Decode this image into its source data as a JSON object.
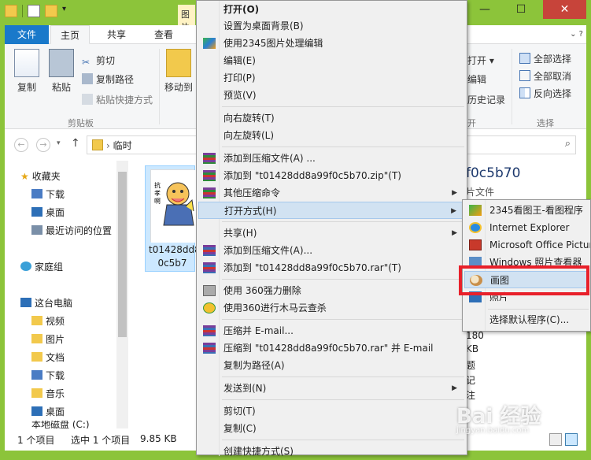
{
  "window": {
    "qat_context_tab": "图片",
    "controls": {
      "minimize": "—",
      "maximize": "☐",
      "close": "✕"
    }
  },
  "ribbon_tabs": {
    "file": "文件",
    "home": "主页",
    "share": "共享",
    "view": "查看",
    "manage": "管",
    "right_icons": "⌄  ?"
  },
  "ribbon": {
    "copy": "复制",
    "paste": "粘贴",
    "cut": "剪切",
    "copy_path": "复制路径",
    "paste_shortcut": "粘贴快捷方式",
    "move_to": "移动到",
    "clipboard_group": "剪贴板",
    "open_menu": "打开",
    "edit": "编辑",
    "history": "历史记录",
    "group_open_tail": "开",
    "select_all": "全部选择",
    "select_none": "全部取消",
    "invert_select": "反向选择",
    "select_group": "选择"
  },
  "address": {
    "path": "临时",
    "back": "←",
    "forward": "→",
    "up": "↑",
    "search_icon": "⌕"
  },
  "navpane": {
    "favorites": "收藏夹",
    "downloads": "下载",
    "desktop": "桌面",
    "recent": "最近访问的位置",
    "homegroup": "家庭组",
    "this_pc": "这台电脑",
    "videos": "视频",
    "pictures": "图片",
    "documents": "文档",
    "downloads2": "下载",
    "music": "音乐",
    "desktop2": "桌面",
    "local_disk": "本地磁盘 (C:)"
  },
  "file": {
    "name_line1": "t01428dd8",
    "name_line2": "0c5b7"
  },
  "details": {
    "title": "f0c5b70",
    "type": "片文件",
    "v1": "180",
    "v2": "KB",
    "v3": "题",
    "v4": "记",
    "v5": "注"
  },
  "status": {
    "count": "1 个项目",
    "selected": "选中 1 个项目",
    "size": "9.85 KB"
  },
  "context_menu": {
    "open": "打开(O)",
    "set_bg": "设置为桌面背景(B)",
    "edit_2345": "使用2345图片处理编辑",
    "edit": "编辑(E)",
    "print": "打印(P)",
    "preview": "预览(V)",
    "rotate_right": "向右旋转(T)",
    "rotate_left": "向左旋转(L)",
    "add_archive": "添加到压缩文件(A) ...",
    "add_zip": "添加到 \"t01428dd8a99f0c5b70.zip\"(T)",
    "other_compress": "其他压缩命令",
    "open_with": "打开方式(H)",
    "share": "共享(H)",
    "add_archive2": "添加到压缩文件(A)...",
    "add_rar": "添加到 \"t01428dd8a99f0c5b70.rar\"(T)",
    "delete_360": "使用 360强力删除",
    "scan_360": "使用360进行木马云查杀",
    "compress_email": "压缩并 E-mail...",
    "compress_rar_email": "压缩到 \"t01428dd8a99f0c5b70.rar\" 并 E-mail",
    "copy_as_path": "复制为路径(A)",
    "send_to": "发送到(N)",
    "cut": "剪切(T)",
    "copy": "复制(C)",
    "create_shortcut": "创建快捷方式(S)",
    "arrow": "▶"
  },
  "submenu": {
    "viewer_2345": "2345看图王-看图程序",
    "ie": "Internet Explorer",
    "ms_office": "Microsoft Office Picture Manager",
    "win_photo": "Windows 照片查看器",
    "paint": "画图",
    "photos": "照片",
    "choose_default": "选择默认程序(C)..."
  },
  "watermark": {
    "brand": "Bai 经验",
    "url": "jingyan.baidu.com"
  },
  "colors": {
    "title_green": "#8cc43a",
    "file_tab": "#1979ca",
    "highlight": "#d1e2f2",
    "red_box": "#e8202a"
  }
}
